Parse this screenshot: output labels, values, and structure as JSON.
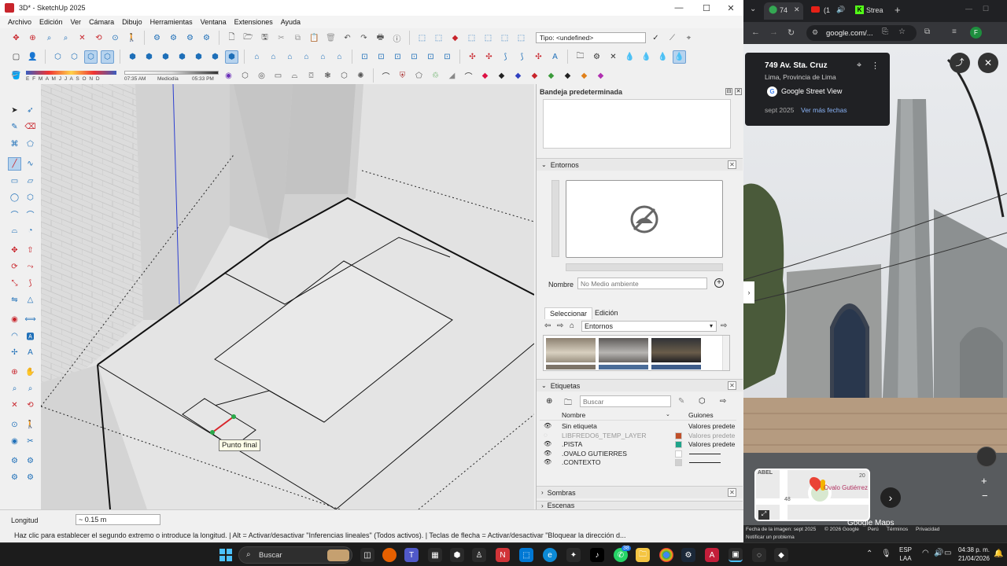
{
  "sketchup": {
    "window_title": "3D* - SketchUp 2025",
    "window_controls": [
      "—",
      "☐",
      "✕"
    ],
    "menu": [
      "Archivo",
      "Edición",
      "Ver",
      "Cámara",
      "Dibujo",
      "Herramientas",
      "Ventana",
      "Extensiones",
      "Ayuda"
    ],
    "tipo_field": "Tipo: <undefined>",
    "months": "E F M A M J J A S O N D",
    "time_start": "07:35 AM",
    "time_mid": "Mediodía",
    "time_end": "05:33 PM",
    "tooltip": "Punto final",
    "tray": {
      "title": "Bandeja predeterminada",
      "entornos": {
        "title": "Entornos",
        "nombre_label": "Nombre",
        "nombre_placeholder": "No Medio ambiente",
        "tab_select": "Seleccionar",
        "tab_edit": "Edición",
        "dropdown": "Entornos"
      },
      "etiquetas": {
        "title": "Etiquetas",
        "search_placeholder": "Buscar",
        "col_name": "Nombre",
        "col_dash": "Guiones",
        "rows": [
          {
            "name": "Sin etiqueta",
            "dash": "Valores predete",
            "color": "",
            "faded": false
          },
          {
            "name": "LIBFREDO6_TEMP_LAYER",
            "dash": "Valores predete",
            "color": "#c0502a",
            "faded": true
          },
          {
            "name": ".PISTA",
            "dash": "Valores predete",
            "color": "#1fa48a",
            "faded": false
          },
          {
            "name": ".OVALO GUTIERRES",
            "dash": "",
            "color": "#ffffff",
            "faded": false
          },
          {
            "name": ".CONTEXTO",
            "dash": "",
            "color": "#d0d0d0",
            "faded": false
          }
        ]
      },
      "sombras": "Sombras",
      "escenas": "Escenas"
    },
    "status": {
      "measure_label": "Longitud",
      "measure_value": "~ 0.15 m",
      "hint": "Haz clic para establecer el segundo extremo o introduce la longitud. | Alt = Activar/desactivar \"Inferencias lineales\" (Todos activos). | Teclas de flecha = Activar/desactivar \"Bloquear la dirección d..."
    }
  },
  "chrome": {
    "tabs": [
      "74",
      "(1",
      "Strea"
    ],
    "url": "google.com/...",
    "profile": "F",
    "place": {
      "address": "749 Av. Sta. Cruz",
      "city": "Lima, Provincia de Lima",
      "service": "Google Street View",
      "date": "sept 2025",
      "more_dates": "Ver más fechas"
    },
    "map_label": "Óvalo Gutiérrez",
    "map_numbers": [
      "20",
      "48"
    ],
    "map_corner": "ABEL",
    "footer": {
      "image_date": "Fecha de la imagen: sept 2025",
      "copyright": "© 2026 Google",
      "country": "Perú",
      "terms": "Términos",
      "privacy": "Privacidad",
      "report": "Notificar un problema",
      "brand": "Google Maps"
    }
  },
  "taskbar": {
    "search": "Buscar",
    "lang": "ESP",
    "lang2": "LAA",
    "time": "04:38 p. m.",
    "date": "21/04/2026",
    "whatsapp_badge": "38"
  },
  "colors": {
    "sketchup_accent": "#1e6fb8",
    "chrome_bg": "#202124",
    "taskbar_bg": "#1c1c1c",
    "pin_red": "#ea4335"
  }
}
